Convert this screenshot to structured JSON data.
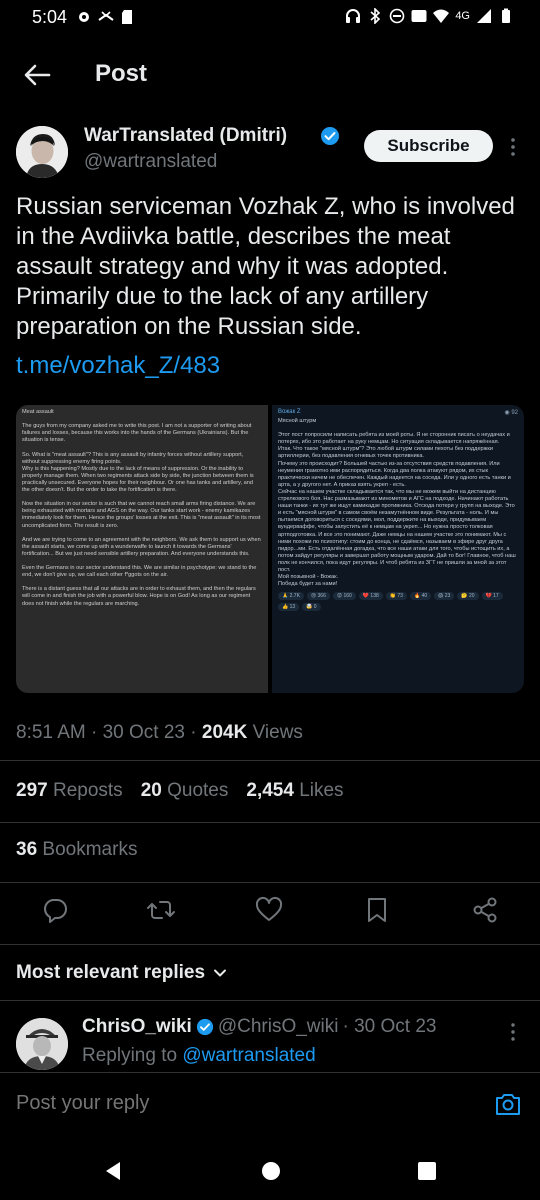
{
  "status_bar": {
    "time": "5:04",
    "network": "4G"
  },
  "header": {
    "title": "Post"
  },
  "author": {
    "name": "WarTranslated (Dmitri)",
    "handle": "@wartranslated",
    "subscribe_label": "Subscribe"
  },
  "post": {
    "text": "Russian serviceman Vozhak Z, who is involved in the Avdiivka battle, describes the meat assault strategy and why it was adopted. Primarily due to the lack of any artillery preparation on the Russian side.",
    "link": "t.me/vozhak_Z/483"
  },
  "images": {
    "left_text": "Meat assault\n\nThe guys from my company asked me to write this post. I am not a supporter of writing about failures and losses, because this works into the hands of the Germans (Ukrainians). But the situation is tense.\n\nSo. What is \"meat assault\"? This is any assault by infantry forces without artillery support, without suppressing enemy firing points.\nWhy is this happening? Mostly due to the lack of means of suppression. Or the inability to properly manage them. When two regiments attack side by side, the junction between them is practically unsecured. Everyone hopes for their neighbour. Or one has tanks and artillery, and the other doesn't. But the order to take the fortification is there.\n\nNow the situation in our sector is such that we cannot reach small arms firing distance. We are being exhausted with mortars and AGS on the way. Our tanks start work - enemy kamikazes immediately look for them. Hence the groups' losses at the exit. This is \"meat assault\" in its most uncomplicated form. The result is zero.\n\nAnd we are trying to come to an agreement with the neighbors. We ask them to support us when the assault starts, we come up with a wunderwaffe to launch it towards the Germans' fortification... But we just need sensible artillery preparation. And everyone understands this.\n\nEven the Germans in our sector understand this. We are similar in psychotype: we stand to the end, we don't give up, we call each other f*ggots on the air.\n\nThere is a distant guess that all our attacks are in order to exhaust them, and then the regulars will come in and finish the job with a powerful blow. Hope is on God! As long as our regiment does not finish while the regulars are marching.",
    "right_header": "Вожак Z",
    "right_counter": "◉ 92",
    "right_text": "Мясной штурм\n\nЭтот пост попросили написать ребята из моей роты. Я не сторонник писать о неудачах и потерях, ибо это работает на руку немцам. Но ситуация складывается напряжённая.\nИтак. Что такое \"мясной штурм\"? Это любой штурм силами пехоты без поддержки артиллерии, без подавления огневых точек противника.\nПочему это происходит? Большей частью из-за отсутствия средств подавления. Или неумения грамотно ими распорядиться. Когда два полка атакуют рядом, их стык практически ничем не обеспечен. Каждый надеется на соседа. Или у одного есть танки и арта, а у другого нет. А приказ взять укреп - есть.\nСейчас на нашем участке складывается так, что мы не можем выйти на дистанцию стрелкового боя. Нас размазывают из минометов и АГС на подходе. Начинают работать наши танки - их тут же ищут камикадзе противника. Отсюда потери у групп на выходе. Это и есть \"мясной штурм\" в самом своём незамутнённом виде. Результата - ноль. И мы пытаемся договориться с соседями, мол, поддержите на выходе, придумываем вундерваффе, чтобы запустить её к немцам на укреп... Но нужна просто толковая артподготовка. И все это понимают. Даже немцы на нашем участке это понимают. Мы с ними похожи по психотипу: стоим до конца, не сдаёмся, называем в эфире друг друга пидор...ми. Есть отдалённая догадка, что все наши атаки для того, чтобы истощить их, а потом зайдут регуляры и завершат работу мощным ударом. Дай то Бог! Главное, чтоб наш полк не кончился, пока идут регуляры. И чтоб ребята из ЗГТ не пришли за мной за этот пост.\nМой позывной - Вожак.\nПобеда будет за нами!",
    "reactions": [
      "🙏 2.7K",
      "😢 366",
      "😡 160",
      "❤️ 138",
      "👏 73",
      "🔥 40",
      "😱 23",
      "🤔 20",
      "💔 17",
      "👍 13",
      "🤯 0"
    ]
  },
  "meta": {
    "time": "8:51 AM",
    "date": "30 Oct 23",
    "views_count": "204K",
    "views_label": "Views"
  },
  "stats": {
    "reposts_count": "297",
    "reposts_label": "Reposts",
    "quotes_count": "20",
    "quotes_label": "Quotes",
    "likes_count": "2,454",
    "likes_label": "Likes",
    "bookmarks_count": "36",
    "bookmarks_label": "Bookmarks"
  },
  "replies": {
    "sort_label": "Most relevant replies",
    "items": [
      {
        "name": "ChrisO_wiki",
        "handle": "@ChrisO_wiki",
        "date": "· 30 Oct 23",
        "replying_prefix": "Replying to",
        "replying_to": "@wartranslated"
      }
    ]
  },
  "reply_box": {
    "placeholder": "Post your reply"
  },
  "colors": {
    "background": "#000000",
    "accent": "#1d9bf0",
    "secondary_text": "#71767b",
    "primary_text": "#e7e9ea"
  }
}
